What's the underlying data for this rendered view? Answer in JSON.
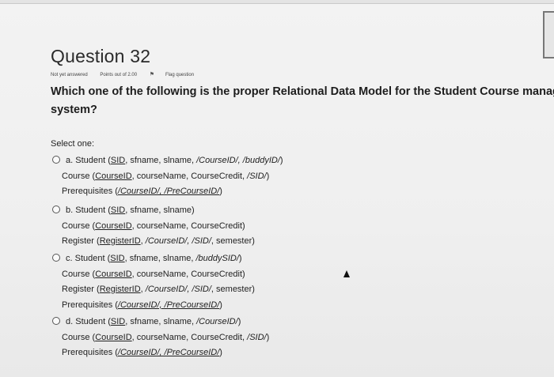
{
  "question": {
    "title": "Question 32",
    "status": "Not yet answered",
    "points": "Points out of 2.00",
    "flag_label": "Flag question",
    "text_line1": "Which one of the following is the proper Relational Data Model for the Student Course managn",
    "text_line2": "system?",
    "select_label": "Select one:"
  },
  "options": [
    {
      "letter": "a.",
      "lines": [
        [
          "Student (",
          "SID",
          ", sfname, slname, ",
          "/CourseID/, /buddyID/",
          ")"
        ],
        [
          "Course (",
          "CourseID",
          ", courseName, CourseCredit, ",
          "/SID/",
          ")"
        ],
        [
          "Prerequisites (",
          "/CourseID/, /PreCourseID/",
          ")"
        ]
      ]
    },
    {
      "letter": "b.",
      "lines": [
        [
          "Student (",
          "SID",
          ", sfname, slname)"
        ],
        [
          "Course (",
          "CourseID",
          ", courseName, CourseCredit)"
        ],
        [
          "Register (",
          "RegisterID",
          ", ",
          "/CourseID/, /SID/",
          ", semester)"
        ]
      ]
    },
    {
      "letter": "c.",
      "lines": [
        [
          "Student (",
          "SID",
          ", sfname, slname, ",
          "/buddySID/",
          ")"
        ],
        [
          "Course (",
          "CourseID",
          ", courseName, CourseCredit)"
        ],
        [
          "Register (",
          "RegisterID",
          ", ",
          "/CourseID/, /SID/",
          ", semester)"
        ],
        [
          "Prerequisites (",
          "/CourseID/, /PreCourseID/",
          ")"
        ]
      ]
    },
    {
      "letter": "d.",
      "lines": [
        [
          "Student (",
          "SID",
          ", sfname, slname, ",
          "/CourseID/",
          ")"
        ],
        [
          "Course (",
          "CourseID",
          ", courseName, CourseCredit, ",
          "/SID/",
          ")"
        ],
        [
          "Prerequisites (",
          "/CourseID/, /PreCourseID/",
          ")"
        ]
      ]
    }
  ]
}
